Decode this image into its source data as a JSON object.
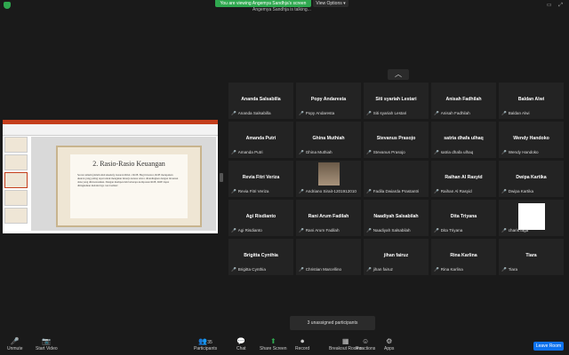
{
  "top": {
    "banner": "You are viewing Angemya Sandhja's screen",
    "view_options": "View Options ▾",
    "sub_banner": "Angemya Sandhja is talking..."
  },
  "slide": {
    "title": "2.  Rasio-Rasio Keuangan",
    "body": "Secara umum (dalam sikit eksekit), besaran ROA = ROE. Bagi investor, ROE merupakan ukuran yang paling tepat untuk mengukur kinerja karena relevo ditandingkan dengan investasi dana yang diinvestasikan. Dengan memperoleh beberapa komponen ROE, ROE dapat ditingkatkan melalui tiga cara berikut:"
  },
  "participants": [
    {
      "name": "Ananda Salsabilla",
      "label": "Ananda Salsabilla"
    },
    {
      "name": "Popy Andaresta",
      "label": "Popy Andaresta"
    },
    {
      "name": "Siti syariah Lestari",
      "label": "Siti syariah Lestari"
    },
    {
      "name": "Anisah Fadhilah",
      "label": "Anisah Fadhilah"
    },
    {
      "name": "Baldan Alwi",
      "label": "Baldan Alwi"
    },
    {
      "name": "Amanda Putri",
      "label": "Amanda Putri"
    },
    {
      "name": "Ghina Muthiah",
      "label": "Ghina Muthiah"
    },
    {
      "name": "Stevanus Prasojo",
      "label": "Stevanus Prasojo"
    },
    {
      "name": "satria dhafa ulhaq",
      "label": "satria dhafa ulhaq"
    },
    {
      "name": "Wendy Handoko",
      "label": "Wendy Handoko"
    },
    {
      "name": "Revia Fitri Veriza",
      "label": "Revia Fitri Veriza"
    },
    {
      "name": "",
      "label": "Andriano Sirait-1201912010",
      "video": "photo"
    },
    {
      "name": "",
      "label": "Fadila Dwiarda Prastantri"
    },
    {
      "name": "Raihan Al Rasyid",
      "label": "Raihan Al Rasyid"
    },
    {
      "name": "Dwipa Kartika",
      "label": "Dwipa Kartika"
    },
    {
      "name": "Agi Risdianto",
      "label": "Agi Risdianto"
    },
    {
      "name": "Rani Arum Fadilah",
      "label": "Rani Arum Fadilah"
    },
    {
      "name": "Naadiyah Salsabilah",
      "label": "Naadiyah Salsabilah"
    },
    {
      "name": "Dita Triyana",
      "label": "Dita Triyana"
    },
    {
      "name": "",
      "label": "charis faga",
      "video": "white"
    },
    {
      "name": "Brigitta Cynthia",
      "label": "Brigitta Cynthia"
    },
    {
      "name": "",
      "label": "Christian Marcellino"
    },
    {
      "name": "jihan fairuz",
      "label": "jihan fairuz"
    },
    {
      "name": "Rina Karlina",
      "label": "Rina Karlina"
    },
    {
      "name": "Tiara",
      "label": "Tiara"
    }
  ],
  "unassigned": "3 unassigned participants",
  "toolbar": {
    "unmute": "Unmute",
    "start_video": "Start Video",
    "participants": "Participants",
    "participants_count": "35",
    "chat": "Chat",
    "share_screen": "Share Screen",
    "record": "Record",
    "breakout_rooms": "Breakout Rooms",
    "reactions": "Reactions",
    "apps": "Apps",
    "leave": "Leave Room"
  },
  "colors": {
    "accent_green": "#2fa84f",
    "leave_blue": "#0e72ed",
    "mic_red": "#e02828"
  }
}
